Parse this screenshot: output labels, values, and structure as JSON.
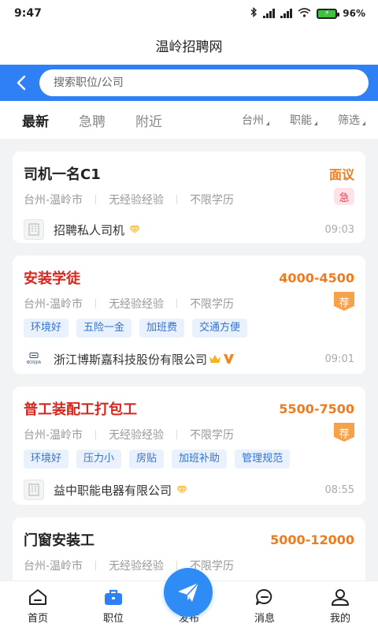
{
  "status_bar": {
    "time": "9:47",
    "battery": "96%"
  },
  "app_title": "温岭招聘网",
  "search": {
    "placeholder": "搜索职位/公司"
  },
  "tabs": [
    {
      "label": "最新",
      "active": true
    },
    {
      "label": "急聘",
      "active": false
    },
    {
      "label": "附近",
      "active": false
    }
  ],
  "filters": [
    {
      "label": "台州"
    },
    {
      "label": "职能"
    },
    {
      "label": "筛选"
    }
  ],
  "jobs": [
    {
      "title": "司机一名C1",
      "salary": "面议",
      "location": "台州-温岭市",
      "experience": "无经验经验",
      "education": "不限学历",
      "badge": "急",
      "tags": [],
      "company": "招聘私人司机",
      "time": "09:03"
    },
    {
      "title": "安装学徒",
      "salary": "4000-4500",
      "location": "台州-温岭市",
      "experience": "无经验经验",
      "education": "不限学历",
      "badge": "荐",
      "tags": [
        "环境好",
        "五险一金",
        "加班费",
        "交通方便"
      ],
      "company": "浙江博斯嘉科技股份有限公司",
      "logo_text": "BOSIJIA",
      "time": "09:01"
    },
    {
      "title": "普工装配工打包工",
      "salary": "5500-7500",
      "location": "台州-温岭市",
      "experience": "无经验经验",
      "education": "不限学历",
      "badge": "荐",
      "tags": [
        "环境好",
        "压力小",
        "房贴",
        "加班补助",
        "管理规范"
      ],
      "company": "益中职能电器有限公司",
      "time": "08:55"
    },
    {
      "title": "门窗安装工",
      "salary": "5000-12000",
      "location": "台州-温岭市",
      "experience": "无经验经验",
      "education": "不限学历"
    }
  ],
  "bottom_nav": [
    {
      "label": "首页",
      "icon": "home-icon"
    },
    {
      "label": "职位",
      "icon": "briefcase-icon"
    },
    {
      "label": "发布",
      "icon": "paper-plane-icon"
    },
    {
      "label": "消息",
      "icon": "message-icon"
    },
    {
      "label": "我的",
      "icon": "profile-icon"
    }
  ],
  "colors": {
    "brand_blue": "#2f80f5",
    "salary_orange": "#f07b1e",
    "title_red": "#d9261c"
  }
}
